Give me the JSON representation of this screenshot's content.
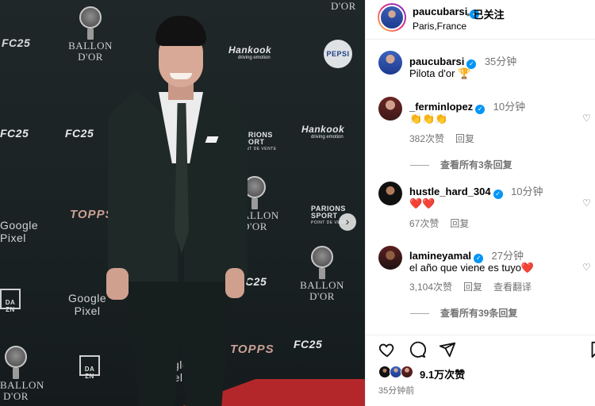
{
  "media": {
    "brand_logos": {
      "ballon_dor": "BALLON\nD'OR",
      "fc25": "FC25",
      "hankook": "Hankook",
      "hankook_tag": "driving emotion",
      "parions": "PARIONS\nSPORT",
      "parions_tag": "POINT DE VENTE",
      "pepsi": "PEPSI",
      "google_pixel": "Google\nPixel",
      "topps": "TOPPS",
      "dazn": "DA\nZN",
      "top_right_dor": "D'OR"
    },
    "next_icon": "chevron-right-icon",
    "next_glyph": "›"
  },
  "header": {
    "username": "paucubarsi",
    "verified_glyph": "✓",
    "separator": "•",
    "follow_status": "已关注",
    "location": "Paris,France"
  },
  "caption": {
    "username": "paucubarsi",
    "time": "35分钟",
    "text": "Pilota d'or 🏆"
  },
  "comments": [
    {
      "username": "_ferminlopez",
      "time": "10分钟",
      "text": "👏👏👏",
      "likes": "382次赞",
      "reply": "回复",
      "view_replies": "查看所有3条回复"
    },
    {
      "username": "hustle_hard_304",
      "time": "10分钟",
      "text": "❤️❤️",
      "likes": "67次赞",
      "reply": "回复"
    },
    {
      "username": "lamineyamal",
      "time": "27分钟",
      "text": "el año que viene es tuyo❤️",
      "likes": "3,104次赞",
      "reply": "回复",
      "translate": "查看翻译",
      "view_replies": "查看所有39条回复"
    }
  ],
  "actions": {
    "like_icon": "heart-icon",
    "comment_icon": "comment-icon",
    "share_icon": "share-icon",
    "save_icon": "bookmark-icon",
    "likes_count": "9.1万次赞",
    "posted_time": "35分钟前"
  },
  "colors": {
    "verified": "#0095f6",
    "muted": "#737373",
    "heart_red": "#e8283a"
  }
}
